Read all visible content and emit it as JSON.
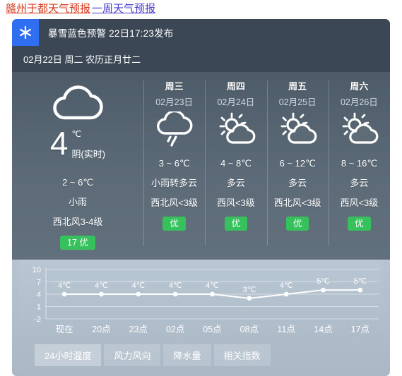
{
  "title": {
    "primary": "赣州于都天气预报",
    "secondary": "一周天气预报"
  },
  "alert": {
    "icon": "snowflake-icon",
    "text": "暴雪蓝色预警 22日17:23发布",
    "badge_color": "#2f6ef0"
  },
  "date_line": "02月22日 周二 农历正月廿二",
  "today": {
    "icon": "cloud-icon",
    "temp": "4",
    "unit": "℃",
    "condition": "阴(实时)",
    "range": "2 ~ 6℃",
    "weather": "小雨",
    "wind": "西北风3-4级",
    "aqi": "17 优",
    "aqi_color": "#37c15c"
  },
  "forecast_days": [
    {
      "dayname": "周三",
      "daydate": "02月23日",
      "icon": "cloud-rain-icon",
      "range": "3 ~ 6℃",
      "weather": "小雨转多云",
      "wind": "西北风<3级",
      "aqi": "优"
    },
    {
      "dayname": "周四",
      "daydate": "02月24日",
      "icon": "sun-cloud-icon",
      "range": "4 ~ 8℃",
      "weather": "多云",
      "wind": "西风<3级",
      "aqi": "优"
    },
    {
      "dayname": "周五",
      "daydate": "02月25日",
      "icon": "sun-cloud-icon",
      "range": "6 ~ 12℃",
      "weather": "多云",
      "wind": "西北风<3级",
      "aqi": "优"
    },
    {
      "dayname": "周六",
      "daydate": "02月26日",
      "icon": "sun-cloud-icon",
      "range": "8 ~ 16℃",
      "weather": "多云",
      "wind": "西风<3级",
      "aqi": "优"
    }
  ],
  "chart_data": {
    "type": "line",
    "title": "",
    "xlabel": "",
    "ylabel": "",
    "categories": [
      "现在",
      "20点",
      "23点",
      "02点",
      "05点",
      "08点",
      "11点",
      "14点",
      "17点"
    ],
    "values": [
      4,
      4,
      4,
      4,
      4,
      3,
      4,
      5,
      5
    ],
    "point_labels": [
      "4℃",
      "4℃",
      "4℃",
      "4℃",
      "4℃",
      "3℃",
      "4℃",
      "5℃",
      "5℃"
    ],
    "yticks": [
      10,
      7,
      4,
      1,
      -2
    ],
    "ylim": [
      -2,
      10
    ],
    "grid": true,
    "legend": "none",
    "line_color": "#ffffff",
    "point_color": "#ffffff"
  },
  "tabs": [
    {
      "label": "24小时温度",
      "active": true
    },
    {
      "label": "风力风向",
      "active": false
    },
    {
      "label": "降水量",
      "active": false
    },
    {
      "label": "相关指数",
      "active": false
    }
  ]
}
